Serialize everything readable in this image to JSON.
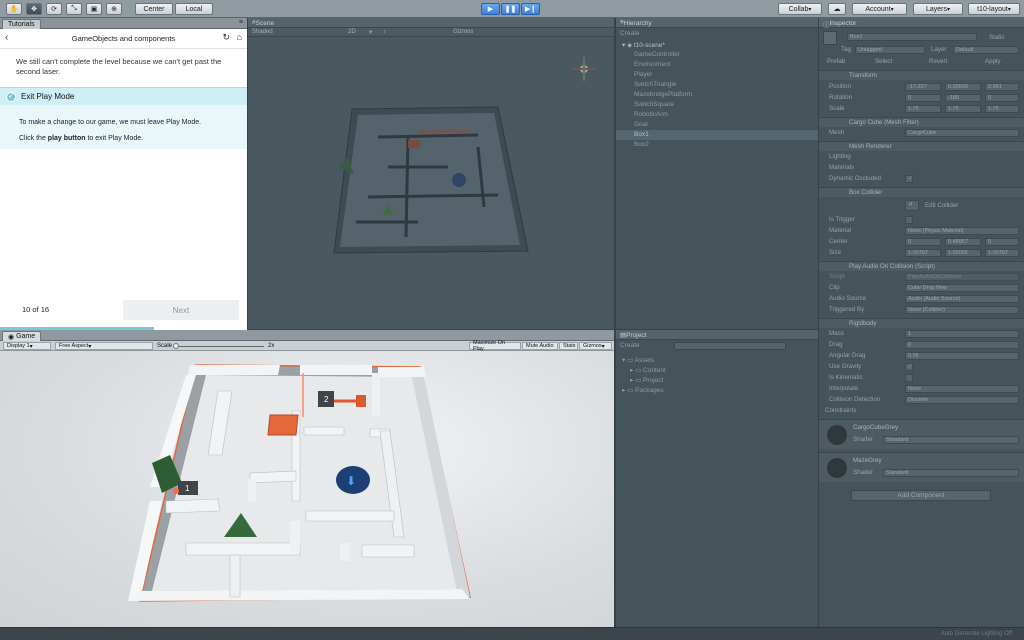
{
  "toolbar": {
    "tools": [
      "hand-tool",
      "move-tool",
      "rotate-tool",
      "scale-tool",
      "rect-tool",
      "transform-tool"
    ],
    "pivot_label": "Center",
    "space_label": "Local",
    "collab_label": "Collab",
    "account_label": "Account",
    "layers_label": "Layers",
    "layout_label": "t10-layout"
  },
  "tutorials": {
    "tab_label": "Tutorials",
    "title": "GameObjects and components",
    "intro": "We still can't complete the level because we can't get past the second laser.",
    "step_label": "Exit Play Mode",
    "desc_line1": "To make a change to our game, we must leave Play Mode.",
    "desc_line2_pre": "Click the ",
    "desc_line2_bold": "play button",
    "desc_line2_post": " to exit Play Mode.",
    "progress": "10 of 16",
    "next_label": "Next",
    "progress_fraction": 0.625
  },
  "scene": {
    "tab_label": "Scene",
    "shading": "Shaded",
    "gizmos": "Gizmos"
  },
  "game": {
    "tab_label": "Game",
    "display": "Display 1",
    "aspect": "Free Aspect",
    "scale_label": "Scale",
    "scale_value": "2x",
    "maximize": "Maximize On Play",
    "mute": "Mute Audio",
    "stats": "Stats",
    "gizmos": "Gizmos",
    "box1_label": "1",
    "box2_label": "2"
  },
  "hierarchy": {
    "tab_label": "Hierarchy",
    "create_label": "Create",
    "scene_name": "t10-scene*",
    "items": [
      "GameController",
      "Environment",
      "Player",
      "SwitchTriangle",
      "MazebridgePlatform",
      "SwitchSquare",
      "RoboticArm",
      "Goal",
      "Box1",
      "Box2"
    ]
  },
  "project": {
    "tab_label": "Project",
    "create_label": "Create",
    "items": [
      "Assets",
      "Content",
      "Project",
      "Packages"
    ]
  },
  "inspector": {
    "tab_label": "Inspector",
    "object_name": "Box1",
    "static_label": "Static",
    "tag_label": "Tag",
    "tag_value": "Untagged",
    "layer_label": "Layer",
    "layer_value": "Default",
    "prefab_buttons": [
      "Prefab",
      "Select",
      "Revert",
      "Apply"
    ],
    "transform": {
      "header": "Transform",
      "position_label": "Position",
      "position": [
        "-17.227",
        "0.03509",
        "2.561"
      ],
      "rotation_label": "Rotation",
      "rotation": [
        "0",
        "-180",
        "0"
      ],
      "scale_label": "Scale",
      "scale": [
        "1.75",
        "1.75",
        "1.75"
      ]
    },
    "mesh_filter": {
      "header": "Cargo Cube (Mesh Filter)",
      "mesh_label": "Mesh",
      "mesh_value": "CargoCube"
    },
    "mesh_renderer": {
      "header": "Mesh Renderer",
      "lighting": "Lighting",
      "materials": "Materials",
      "dynamic_occluded": "Dynamic Occluded"
    },
    "box_collider": {
      "header": "Box Collider",
      "edit_label": "Edit Collider",
      "trigger_label": "Is Trigger",
      "material_label": "Material",
      "material_value": "None (Physic Material)",
      "center_label": "Center",
      "center": [
        "0",
        "0.48957",
        "0"
      ],
      "size_label": "Size",
      "size": [
        "1.00797",
        "1.02005",
        "1.00797"
      ]
    },
    "audio": {
      "header": "Play Audio On Collision (Script)",
      "script_label": "Script",
      "script_value": "PlayAudioOnCollision",
      "clip_label": "Clip",
      "clip_value": "Cube Drop New",
      "source_label": "Audio Source",
      "source_value": "Audio (Audio Source)",
      "triggered_label": "Triggered By",
      "triggered_value": "None (Collider)"
    },
    "rigidbody": {
      "header": "Rigidbody",
      "mass_label": "Mass",
      "mass": "1",
      "drag_label": "Drag",
      "drag": "0",
      "angular_label": "Angular Drag",
      "angular": "0.05",
      "gravity_label": "Use Gravity",
      "kinematic_label": "Is Kinematic",
      "interpolate_label": "Interpolate",
      "interpolate": "None",
      "collision_label": "Collision Detection",
      "collision": "Discrete",
      "constraints_label": "Constraints"
    },
    "materials": [
      {
        "name": "CargoCubeGrey",
        "shader_label": "Shader",
        "shader": "Standard"
      },
      {
        "name": "MazeGrey",
        "shader_label": "Shader",
        "shader": "Standard"
      }
    ],
    "add_component": "Add Component"
  },
  "status": {
    "text": "Auto Generate Lighting Off"
  }
}
